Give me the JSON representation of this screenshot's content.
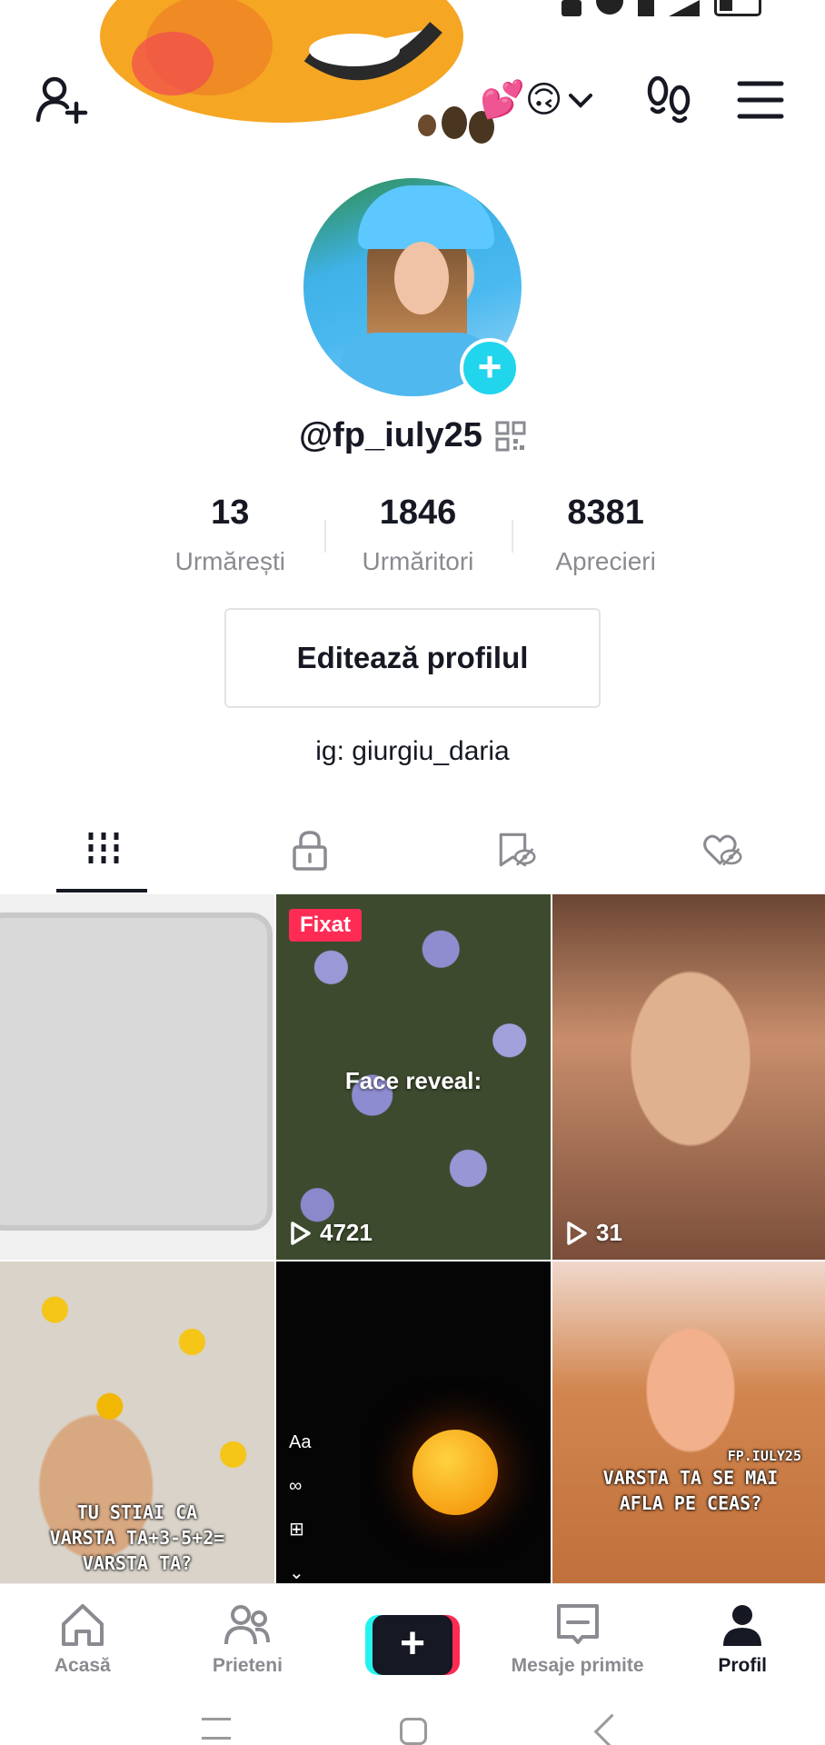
{
  "status_bar": {
    "icons": [
      "nfc-icon",
      "wifi-icon",
      "lte-icon",
      "signal-icon",
      "battery-icon"
    ]
  },
  "header": {
    "emoji": "💕🙃",
    "icons": [
      "add-friend-icon",
      "chevron-down-icon",
      "footprint-icon",
      "menu-icon"
    ]
  },
  "profile": {
    "username": "@fp_iuly25",
    "avatar_add": "+",
    "stats": [
      {
        "value": "13",
        "label": "Urmărești"
      },
      {
        "value": "1846",
        "label": "Urmăritori"
      },
      {
        "value": "8381",
        "label": "Aprecieri"
      }
    ],
    "edit_button": "Editează profilul",
    "bio": "ig: giurgiu_daria"
  },
  "tabs": [
    {
      "name": "videos",
      "icon": "grid-icon",
      "active": true
    },
    {
      "name": "private",
      "icon": "lock-icon",
      "active": false
    },
    {
      "name": "saved",
      "icon": "bookmark-icon",
      "active": false
    },
    {
      "name": "liked",
      "icon": "heart-icon",
      "active": false
    }
  ],
  "videos": [
    {
      "views": ""
    },
    {
      "badge": "Fixat",
      "caption": "Face reveal:",
      "views": "4721"
    },
    {
      "views": "31"
    },
    {
      "overlay_text_1": "TU STIAI CA",
      "overlay_text_2": "VARSTA TA+3-5+2=",
      "overlay_text_3": "VARSTA TA?"
    },
    {
      "tool_label": "Aa"
    },
    {
      "overlay_text_1": "FP.IULY25",
      "overlay_text_2": "VARSTA TA SE MAI",
      "overlay_text_3": "AFLA PE CEAS?"
    }
  ],
  "bottom_nav": [
    {
      "label": "Acasă",
      "icon": "home-icon"
    },
    {
      "label": "Prieteni",
      "icon": "friends-icon"
    },
    {
      "label": "",
      "icon": "create-icon",
      "symbol": "+"
    },
    {
      "label": "Mesaje primite",
      "icon": "inbox-icon"
    },
    {
      "label": "Profil",
      "icon": "profile-icon"
    }
  ],
  "colors": {
    "accent_pink": "#fe2c55",
    "accent_cyan": "#25f4ee",
    "avatar_add": "#20d5ec",
    "text_primary": "#161823",
    "text_secondary": "#8a8b91"
  }
}
